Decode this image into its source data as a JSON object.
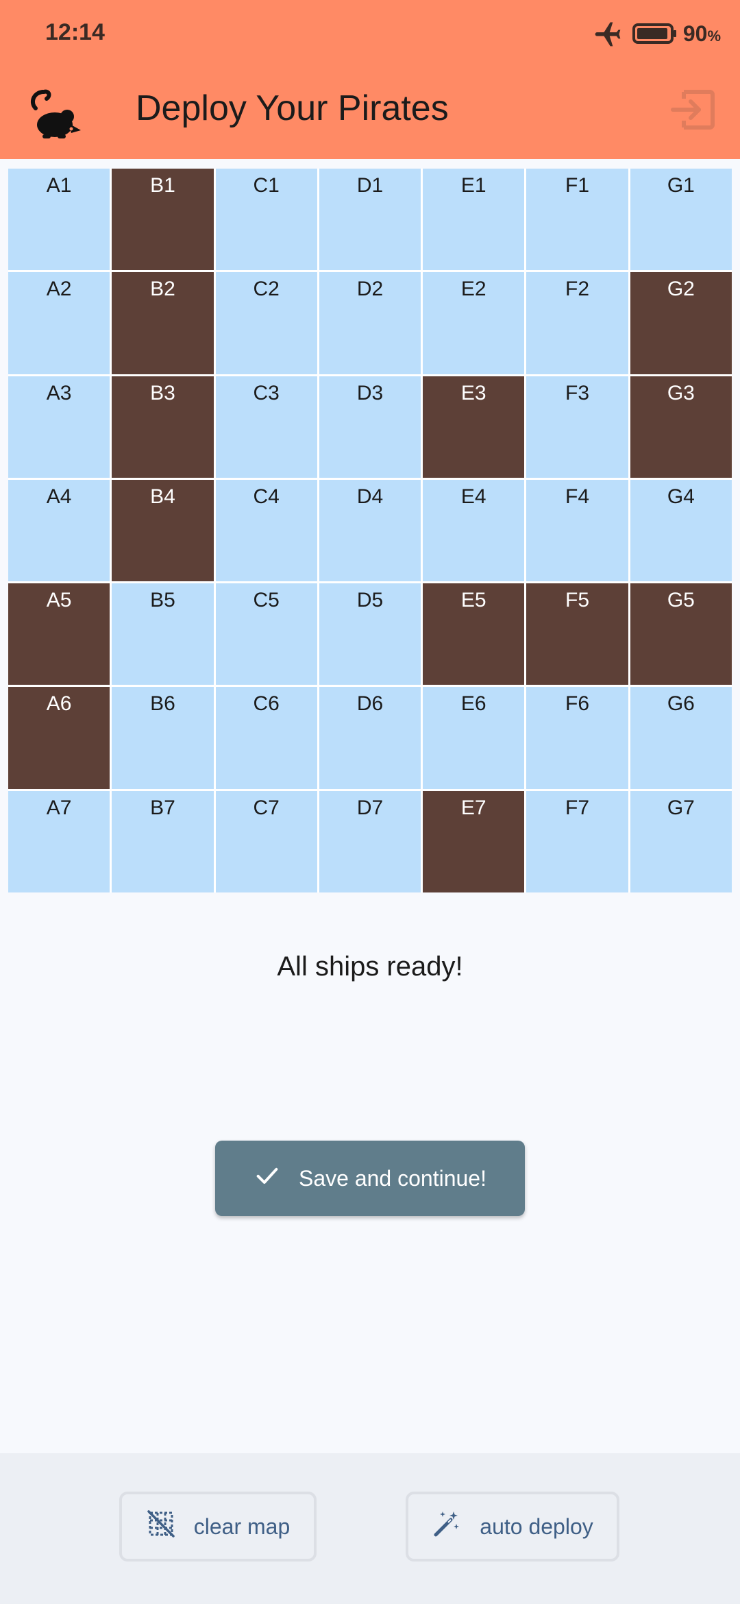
{
  "status_bar": {
    "time": "12:14",
    "battery_percent": "90",
    "battery_unit": "%",
    "icons": [
      "airplane-mode-icon",
      "battery-icon"
    ]
  },
  "header": {
    "title": "Deploy Your Pirates",
    "logo_icon": "rat-icon",
    "exit_icon": "exit-icon"
  },
  "board": {
    "rows": [
      [
        {
          "label": "A1",
          "occupied": false
        },
        {
          "label": "B1",
          "occupied": true
        },
        {
          "label": "C1",
          "occupied": false
        },
        {
          "label": "D1",
          "occupied": false
        },
        {
          "label": "E1",
          "occupied": false
        },
        {
          "label": "F1",
          "occupied": false
        },
        {
          "label": "G1",
          "occupied": false
        }
      ],
      [
        {
          "label": "A2",
          "occupied": false
        },
        {
          "label": "B2",
          "occupied": true
        },
        {
          "label": "C2",
          "occupied": false
        },
        {
          "label": "D2",
          "occupied": false
        },
        {
          "label": "E2",
          "occupied": false
        },
        {
          "label": "F2",
          "occupied": false
        },
        {
          "label": "G2",
          "occupied": true
        }
      ],
      [
        {
          "label": "A3",
          "occupied": false
        },
        {
          "label": "B3",
          "occupied": true
        },
        {
          "label": "C3",
          "occupied": false
        },
        {
          "label": "D3",
          "occupied": false
        },
        {
          "label": "E3",
          "occupied": true
        },
        {
          "label": "F3",
          "occupied": false
        },
        {
          "label": "G3",
          "occupied": true
        }
      ],
      [
        {
          "label": "A4",
          "occupied": false
        },
        {
          "label": "B4",
          "occupied": true
        },
        {
          "label": "C4",
          "occupied": false
        },
        {
          "label": "D4",
          "occupied": false
        },
        {
          "label": "E4",
          "occupied": false
        },
        {
          "label": "F4",
          "occupied": false
        },
        {
          "label": "G4",
          "occupied": false
        }
      ],
      [
        {
          "label": "A5",
          "occupied": true
        },
        {
          "label": "B5",
          "occupied": false
        },
        {
          "label": "C5",
          "occupied": false
        },
        {
          "label": "D5",
          "occupied": false
        },
        {
          "label": "E5",
          "occupied": true
        },
        {
          "label": "F5",
          "occupied": true
        },
        {
          "label": "G5",
          "occupied": true
        }
      ],
      [
        {
          "label": "A6",
          "occupied": true
        },
        {
          "label": "B6",
          "occupied": false
        },
        {
          "label": "C6",
          "occupied": false
        },
        {
          "label": "D6",
          "occupied": false
        },
        {
          "label": "E6",
          "occupied": false
        },
        {
          "label": "F6",
          "occupied": false
        },
        {
          "label": "G6",
          "occupied": false
        }
      ],
      [
        {
          "label": "A7",
          "occupied": false
        },
        {
          "label": "B7",
          "occupied": false
        },
        {
          "label": "C7",
          "occupied": false
        },
        {
          "label": "D7",
          "occupied": false
        },
        {
          "label": "E7",
          "occupied": true
        },
        {
          "label": "F7",
          "occupied": false
        },
        {
          "label": "G7",
          "occupied": false
        }
      ]
    ]
  },
  "main": {
    "status_message": "All ships ready!",
    "save_label": "Save and continue!",
    "save_icon": "check-icon"
  },
  "bottom_bar": {
    "clear_label": "clear map",
    "clear_icon": "grid-off-icon",
    "deploy_label": "auto deploy",
    "deploy_icon": "magic-wand-icon"
  },
  "colors": {
    "header_bg": "#ff8a65",
    "water_cell": "#bbdefb",
    "ship_cell": "#5d4037",
    "save_button_bg": "#607d8b",
    "bottom_button_text": "#3f5f86",
    "page_bg": "#f7f9fd",
    "bottom_bar_bg": "#eceff4"
  }
}
